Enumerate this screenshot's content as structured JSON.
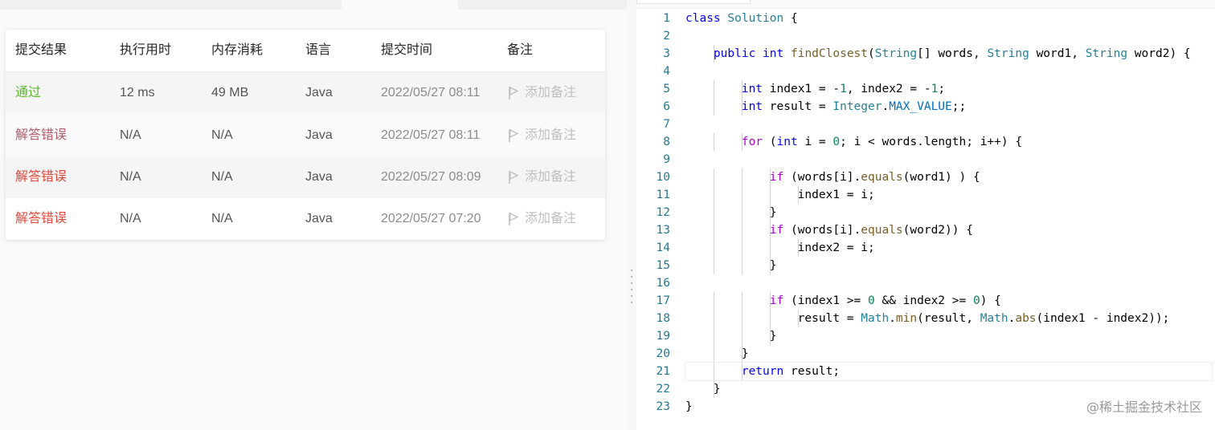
{
  "submissions": {
    "columns": [
      "提交结果",
      "执行用时",
      "内存消耗",
      "语言",
      "提交时间",
      "备注"
    ],
    "rows": [
      {
        "status": "通过",
        "status_color": "#5cb82a",
        "runtime": "12 ms",
        "memory": "49 MB",
        "language": "Java",
        "time": "2022/05/27 08:11",
        "note": "添加备注"
      },
      {
        "status": "解答错误",
        "status_color": "#b05c6a",
        "runtime": "N/A",
        "memory": "N/A",
        "language": "Java",
        "time": "2022/05/27 08:11",
        "note": "添加备注"
      },
      {
        "status": "解答错误",
        "status_color": "#e0493d",
        "runtime": "N/A",
        "memory": "N/A",
        "language": "Java",
        "time": "2022/05/27 08:09",
        "note": "添加备注"
      },
      {
        "status": "解答错误",
        "status_color": "#e0493d",
        "runtime": "N/A",
        "memory": "N/A",
        "language": "Java",
        "time": "2022/05/27 07:20",
        "note": "添加备注"
      }
    ],
    "note_icon": "flag-icon"
  },
  "editor": {
    "current_line": 21,
    "line_numbers": [
      "1",
      "2",
      "3",
      "4",
      "5",
      "6",
      "7",
      "8",
      "9",
      "10",
      "11",
      "12",
      "13",
      "14",
      "15",
      "16",
      "17",
      "18",
      "19",
      "20",
      "21",
      "22",
      "23"
    ],
    "lines": [
      "class Solution {",
      "",
      "    public int findClosest(String[] words, String word1, String word2) {",
      "",
      "        int index1 = -1, index2 = -1;",
      "        int result = Integer.MAX_VALUE;;",
      "",
      "        for (int i = 0; i < words.length; i++) {",
      "",
      "            if (words[i].equals(word1) ) {",
      "                index1 = i;",
      "            }",
      "            if (words[i].equals(word2)) {",
      "                index2 = i;",
      "            }",
      "",
      "            if (index1 >= 0 && index2 >= 0) {",
      "                result = Math.min(result, Math.abs(index1 - index2));",
      "            }",
      "        }",
      "        return result;",
      "    }",
      "}"
    ]
  },
  "watermark": "@稀土掘金技术社区"
}
